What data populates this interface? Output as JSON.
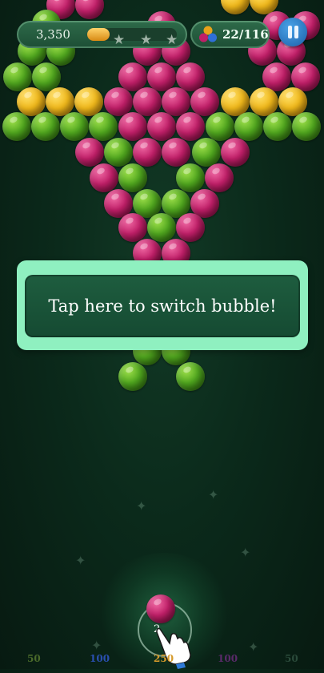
{
  "hud": {
    "score": "3,350",
    "progress_fraction": 0.25,
    "stars_total": 3,
    "bubbles_count": "22/116"
  },
  "tooltip": {
    "text": "Tap here to switch bubble!"
  },
  "shooter": {
    "current_color": "magenta",
    "next_count": "2"
  },
  "score_slots": [
    {
      "label": "50",
      "color": "#4a6a2a"
    },
    {
      "label": "100",
      "color": "#2a4fb0"
    },
    {
      "label": "250",
      "color": "#d69a2a"
    },
    {
      "label": "100",
      "color": "#5a2a6a"
    },
    {
      "label": "50",
      "color": "#2a4a3a"
    }
  ],
  "colors": {
    "green": "#4fa51e",
    "magenta": "#c01f68",
    "yellow": "#f0b81b",
    "tooltip_border": "#8ff0c0",
    "pause_button": "#1c5fa8"
  }
}
